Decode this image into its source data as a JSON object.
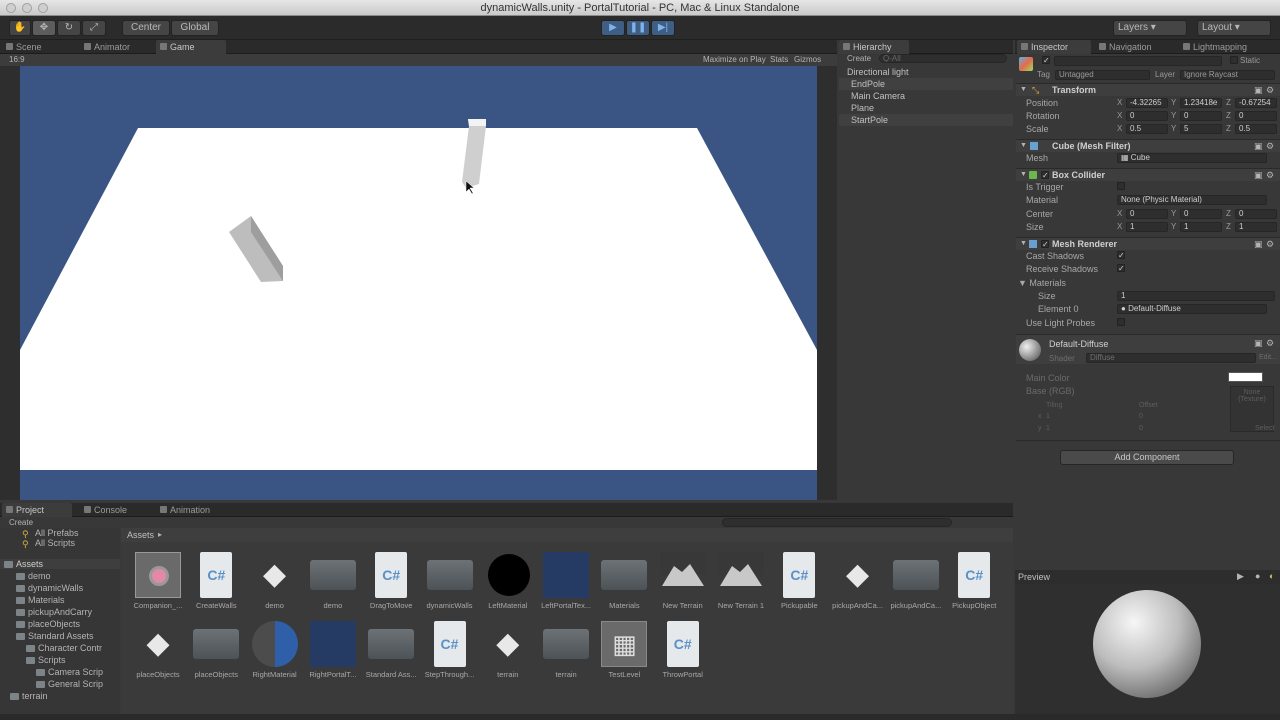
{
  "window": {
    "title": "dynamicWalls.unity - PortalTutorial - PC, Mac & Linux Standalone"
  },
  "toolbar": {
    "center_label": "Center",
    "global_label": "Global",
    "layers_label": "Layers",
    "layout_label": "Layout"
  },
  "scene_tabs": {
    "scene": "Scene",
    "animator": "Animator",
    "game": "Game"
  },
  "game_view": {
    "aspect": "16:9",
    "maximize_label": "Maximize on Play",
    "stats_label": "Stats",
    "gizmos_label": "Gizmos",
    "sky_color": "#3a5583",
    "ground_color": "#ffffff"
  },
  "hierarchy": {
    "tab": "Hierarchy",
    "create": "Create",
    "search_placeholder": "Q-All",
    "items": [
      "Directional light",
      "EndPole",
      "Main Camera",
      "Plane",
      "StartPole"
    ]
  },
  "inspector": {
    "tabs": {
      "inspector": "Inspector",
      "navigation": "Navigation",
      "lightmapping": "Lightmapping"
    },
    "static_label": "Static",
    "tag_label": "Tag",
    "tag_value": "Untagged",
    "layer_label": "Layer",
    "layer_value": "Ignore Raycast",
    "transform": {
      "title": "Transform",
      "position_label": "Position",
      "position": [
        "-4.32265",
        "1.23418e",
        "-0.67254"
      ],
      "rotation_label": "Rotation",
      "rotation": [
        "0",
        "0",
        "0"
      ],
      "scale_label": "Scale",
      "scale": [
        "0.5",
        "5",
        "0.5"
      ]
    },
    "mesh_filter": {
      "title": "Cube (Mesh Filter)",
      "mesh_label": "Mesh",
      "mesh_value": "Cube"
    },
    "box_collider": {
      "title": "Box Collider",
      "is_trigger_label": "Is Trigger",
      "material_label": "Material",
      "material_value": "None (Physic Material)",
      "center_label": "Center",
      "center": [
        "0",
        "0",
        "0"
      ],
      "size_label": "Size",
      "size": [
        "1",
        "1",
        "1"
      ]
    },
    "mesh_renderer": {
      "title": "Mesh Renderer",
      "cast_shadows_label": "Cast Shadows",
      "receive_shadows_label": "Receive Shadows",
      "materials_label": "Materials",
      "size_label": "Size",
      "size_value": "1",
      "element0_label": "Element 0",
      "element0_value": "Default-Diffuse",
      "light_probes_label": "Use Light Probes"
    },
    "material": {
      "title": "Default-Diffuse",
      "shader_label": "Shader",
      "shader_value": "Diffuse",
      "edit_label": "Edit...",
      "main_color_label": "Main Color",
      "base_label": "Base (RGB)",
      "tiling_label": "Tiling",
      "offset_label": "Offset",
      "x_label": "x",
      "y_label": "y",
      "tiling_x": "1",
      "tiling_y": "1",
      "offset_x": "0",
      "offset_y": "0",
      "none_texture": "None (Texture)",
      "select_label": "Select"
    },
    "add_component": "Add Component",
    "preview_label": "Preview"
  },
  "project": {
    "tabs": {
      "project": "Project",
      "console": "Console",
      "animation": "Animation"
    },
    "create": "Create",
    "breadcrumb": "Assets",
    "tree": [
      "All Prefabs",
      "All Scripts",
      "Assets",
      "demo",
      "dynamicWalls",
      "Materials",
      "pickupAndCarry",
      "placeObjects",
      "Standard Assets",
      "Character Contr",
      "Scripts",
      "Camera Scrip",
      "General Scrip",
      "terrain"
    ],
    "assets_row1": [
      {
        "name": "Companion_...",
        "kind": "companion"
      },
      {
        "name": "CreateWalls",
        "kind": "cs"
      },
      {
        "name": "demo",
        "kind": "unity"
      },
      {
        "name": "demo",
        "kind": "folder"
      },
      {
        "name": "DragToMove",
        "kind": "cs"
      },
      {
        "name": "dynamicWalls",
        "kind": "folder"
      },
      {
        "name": "LeftMaterial",
        "kind": "black"
      },
      {
        "name": "LeftPortalTex...",
        "kind": "bluetex"
      },
      {
        "name": "Materials",
        "kind": "folder"
      },
      {
        "name": "New Terrain",
        "kind": "terrain"
      },
      {
        "name": "New Terrain 1",
        "kind": "terrain"
      },
      {
        "name": "Pickupable",
        "kind": "cs"
      },
      {
        "name": "pickupAndCa...",
        "kind": "unity"
      },
      {
        "name": "pickupAndCa...",
        "kind": "folder"
      },
      {
        "name": "PickupObject",
        "kind": "cs"
      }
    ],
    "assets_row2": [
      {
        "name": "placeObjects",
        "kind": "unity"
      },
      {
        "name": "placeObjects",
        "kind": "folder"
      },
      {
        "name": "RightMaterial",
        "kind": "halfsphere"
      },
      {
        "name": "RightPortalT...",
        "kind": "bluetex"
      },
      {
        "name": "Standard Ass...",
        "kind": "folder"
      },
      {
        "name": "StepThrough...",
        "kind": "cs"
      },
      {
        "name": "terrain",
        "kind": "unity"
      },
      {
        "name": "terrain",
        "kind": "folder"
      },
      {
        "name": "TestLevel",
        "kind": "prefab"
      },
      {
        "name": "ThrowPortal",
        "kind": "cs"
      }
    ]
  }
}
